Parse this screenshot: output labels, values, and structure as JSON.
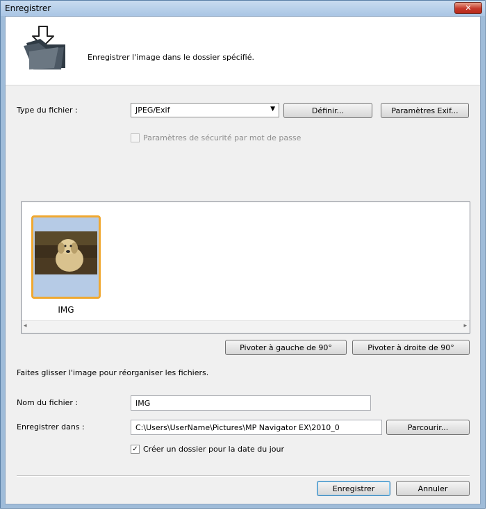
{
  "window": {
    "title": "Enregistrer",
    "close_label": "✕"
  },
  "header": {
    "description": "Enregistrer l'image dans le dossier spécifié.",
    "icon": "save-to-folder-icon"
  },
  "file_type": {
    "label": "Type du fichier :",
    "selected": "JPEG/Exif",
    "define_button": "Définir...",
    "exif_button": "Paramètres Exif..."
  },
  "password_security": {
    "label": "Paramètres de sécurité par mot de passe",
    "checked": false,
    "enabled": false
  },
  "preview": {
    "thumbnail_label": "IMG",
    "selection_color": "#f0a830"
  },
  "rotate": {
    "left_button": "Pivoter à gauche de 90°",
    "right_button": "Pivoter à droite de 90°"
  },
  "hint": "Faites glisser l'image pour réorganiser les fichiers.",
  "file_name": {
    "label": "Nom du fichier :",
    "value": "IMG"
  },
  "save_in": {
    "label": "Enregistrer dans :",
    "value": "C:\\Users\\UserName\\Pictures\\MP Navigator EX\\2010_0",
    "browse_button": "Parcourir..."
  },
  "date_folder": {
    "label": "Créer un dossier pour la date du jour",
    "checked": true
  },
  "actions": {
    "save": "Enregistrer",
    "cancel": "Annuler"
  }
}
